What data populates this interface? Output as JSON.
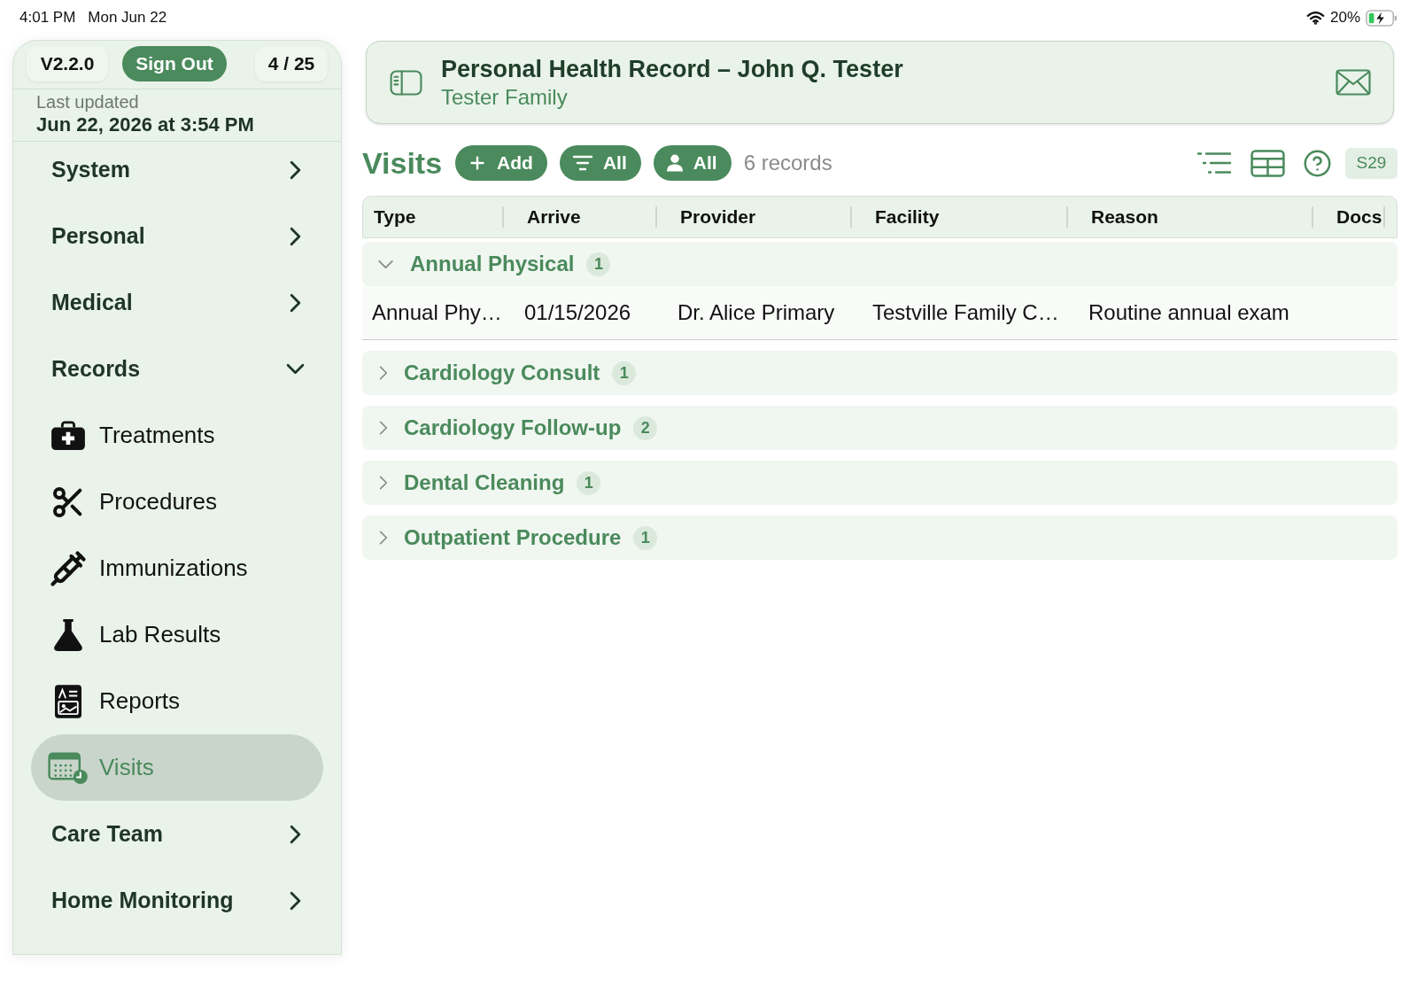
{
  "status_bar": {
    "time": "4:01 PM",
    "date": "Mon Jun 22",
    "battery": "20%"
  },
  "sidebar": {
    "version": "V2.2.0",
    "sign_out": "Sign Out",
    "page_count": "4 / 25",
    "last_updated_label": "Last updated",
    "last_updated": "Jun 22, 2026 at 3:54 PM",
    "items": [
      {
        "label": "System",
        "expanded": false
      },
      {
        "label": "Personal",
        "expanded": false
      },
      {
        "label": "Medical",
        "expanded": false
      },
      {
        "label": "Records",
        "expanded": true,
        "children": [
          {
            "label": "Treatments",
            "selected": false
          },
          {
            "label": "Procedures",
            "selected": false
          },
          {
            "label": "Immunizations",
            "selected": false
          },
          {
            "label": "Lab Results",
            "selected": false
          },
          {
            "label": "Reports",
            "selected": false
          },
          {
            "label": "Visits",
            "selected": true
          }
        ]
      },
      {
        "label": "Care Team",
        "expanded": false
      },
      {
        "label": "Home Monitoring",
        "expanded": false
      }
    ]
  },
  "header": {
    "title": "Personal Health Record – John Q. Tester",
    "subtitle": "Tester Family"
  },
  "toolbar": {
    "title": "Visits",
    "buttons": [
      {
        "kind": "add",
        "label": "Add"
      },
      {
        "kind": "filter",
        "label": "All"
      },
      {
        "kind": "person",
        "label": "All"
      }
    ],
    "record_count": "6 records",
    "screen_code": "S29"
  },
  "table": {
    "columns": [
      "Type",
      "Arrive",
      "Provider",
      "Facility",
      "Reason",
      "Docs"
    ],
    "groups": [
      {
        "name": "Annual Physical",
        "count": "1",
        "expanded": true,
        "rows": [
          {
            "cells": [
              "Annual Phy…",
              "01/15/2026",
              "Dr. Alice Primary",
              "Testville Family C…",
              "Routine annual exam"
            ]
          }
        ]
      },
      {
        "name": "Cardiology Consult",
        "count": "1",
        "expanded": false
      },
      {
        "name": "Cardiology Follow-up",
        "count": "2",
        "expanded": false
      },
      {
        "name": "Dental Cleaning",
        "count": "1",
        "expanded": false
      },
      {
        "name": "Outpatient Procedure",
        "count": "1",
        "expanded": false
      }
    ]
  }
}
